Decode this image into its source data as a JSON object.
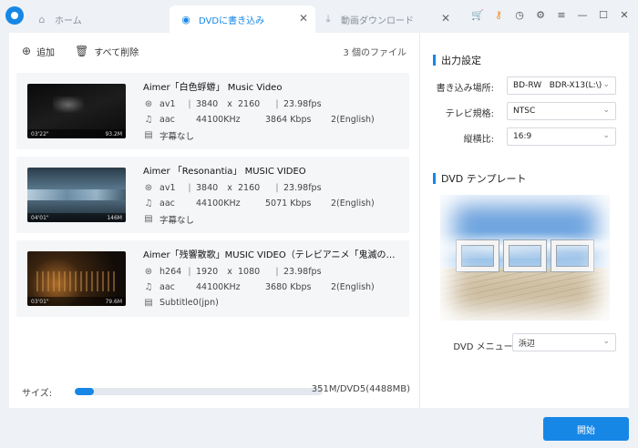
{
  "tabs": {
    "home": {
      "label": "ホーム"
    },
    "dvd": {
      "label": "DVDに書き込み"
    },
    "download": {
      "label": "動画ダウンロード"
    }
  },
  "toolbar": {
    "add_label": "追加",
    "delete_all_label": "すべて削除",
    "file_count": "3 個のファイル"
  },
  "items": [
    {
      "title": "Aimer「白色蜉蝣」 Music Video",
      "thumb_duration": "03'22\"",
      "thumb_size": "93.2M",
      "video": {
        "codec": "av1",
        "width": "3840",
        "height": "2160",
        "fps": "23.98fps"
      },
      "audio": {
        "codec": "aac",
        "rate": "44100KHz",
        "bitrate": "3864 Kbps",
        "channels": "2(English)"
      },
      "subtitle": "字幕なし"
    },
    {
      "title": "Aimer 「Resonantia」 MUSIC VIDEO",
      "thumb_duration": "04'01\"",
      "thumb_size": "146M",
      "video": {
        "codec": "av1",
        "width": "3840",
        "height": "2160",
        "fps": "23.98fps"
      },
      "audio": {
        "codec": "aac",
        "rate": "44100KHz",
        "bitrate": "5071 Kbps",
        "channels": "2(English)"
      },
      "subtitle": "字幕なし"
    },
    {
      "title": "Aimer「残響散歌」MUSIC VIDEO（テレビアニメ「鬼滅の刃」...",
      "thumb_duration": "03'01\"",
      "thumb_size": "79.6M",
      "video": {
        "codec": "h264",
        "width": "1920",
        "height": "1080",
        "fps": "23.98fps"
      },
      "audio": {
        "codec": "aac",
        "rate": "44100KHz",
        "bitrate": "3680 Kbps",
        "channels": "2(English)"
      },
      "subtitle": "Subtitle0(jpn)"
    }
  ],
  "size": {
    "label": "サイズ:",
    "value_text": "351M/DVD5(4488MB)",
    "progress_fraction": 0.078
  },
  "output": {
    "title": "出力設定",
    "location_label": "書き込み場所:",
    "location_value": "BD-RW   BDR-X13(L:\\)",
    "tv_label": "テレビ規格:",
    "tv_value": "NTSC",
    "aspect_label": "縦横比:",
    "aspect_value": "16:9"
  },
  "template": {
    "title": "DVD テンプレート",
    "menu_label": "DVD メニュー:",
    "menu_value": "浜辺"
  },
  "start_label": "開始",
  "colors": {
    "accent": "#1787e6",
    "icon_orange": "#f28a2e"
  }
}
